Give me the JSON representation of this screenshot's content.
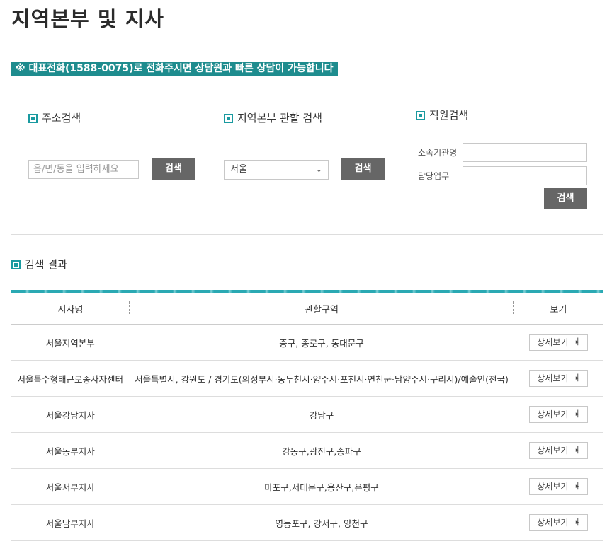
{
  "page_title": "지역본부 및 지사",
  "notice": "※ 대표전화(1588-0075)로 전화주시면 상담원과 빠른 상담이 가능합니다",
  "address_search": {
    "title": "주소검색",
    "placeholder": "읍/면/동을 입력하세요",
    "button": "검색"
  },
  "region_search": {
    "title": "지역본부 관할 검색",
    "selected": "서울",
    "button": "검색"
  },
  "staff_search": {
    "title": "직원검색",
    "org_label": "소속기관명",
    "duty_label": "담당업무",
    "button": "검색"
  },
  "results": {
    "title": "검색 결과",
    "columns": [
      "지사명",
      "관할구역",
      "보기"
    ],
    "detail_label": "상세보기",
    "rows": [
      {
        "name": "서울지역본부",
        "area": "중구, 종로구, 동대문구"
      },
      {
        "name": "서울특수형태근로종사자센터",
        "area": "서울특별시, 강원도 / 경기도(의정부시·동두천시·양주시·포천시·연천군·남양주시·구리시)/예술인(전국)"
      },
      {
        "name": "서울강남지사",
        "area": "강남구"
      },
      {
        "name": "서울동부지사",
        "area": "강동구,광진구,송파구"
      },
      {
        "name": "서울서부지사",
        "area": "마포구,서대문구,용산구,은평구"
      },
      {
        "name": "서울남부지사",
        "area": "영등포구, 강서구, 양천구"
      }
    ]
  }
}
